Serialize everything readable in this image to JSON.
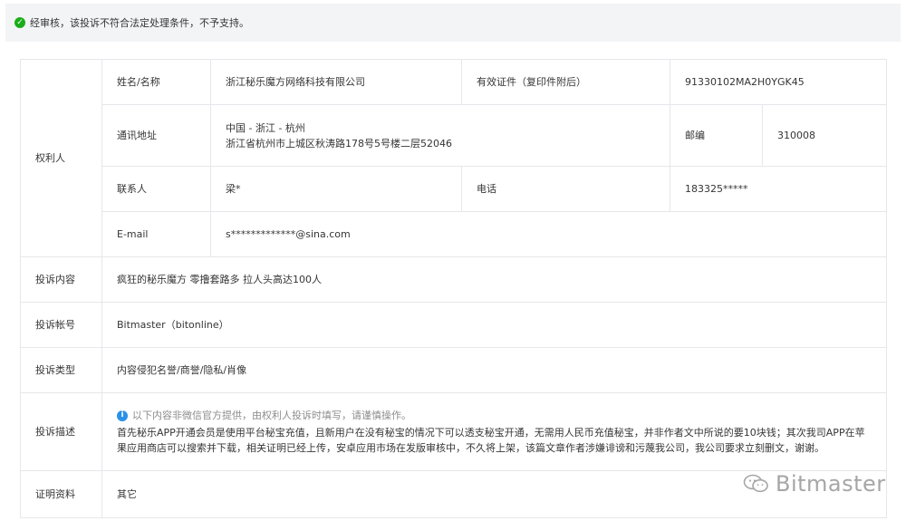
{
  "notice": {
    "text": "经审核，该投诉不符合法定处理条件，不予支持。",
    "icon": "check-circle-icon",
    "color": "#1aad19"
  },
  "rights_holder": {
    "section_label": "权利人",
    "name_label": "姓名/名称",
    "name_value": "浙江秘乐魔方网络科技有限公司",
    "cert_label": "有效证件（复印件附后）",
    "cert_value": "91330102MA2H0YGK45",
    "address_label": "通讯地址",
    "address_line1": "中国 - 浙江 - 杭州",
    "address_line2": "浙江省杭州市上城区秋涛路178号5号楼二层52046",
    "postcode_label": "邮编",
    "postcode_value": "310008",
    "contact_label": "联系人",
    "contact_value": "梁*",
    "phone_label": "电话",
    "phone_value": "183325*****",
    "email_label": "E-mail",
    "email_value": "s*************@sina.com"
  },
  "complaint": {
    "content_label": "投诉内容",
    "content_value": "疯狂的秘乐魔方 零撸套路多 拉人头高达100人",
    "account_label": "投诉帐号",
    "account_value": "Bitmaster（bitonline）",
    "type_label": "投诉类型",
    "type_value": "内容侵犯名誉/商誉/隐私/肖像",
    "desc_label": "投诉描述",
    "desc_tip": "以下内容非微信官方提供，由权利人投诉时填写，请谨慎操作。",
    "desc_text": "首先秘乐APP开通会员是使用平台秘宝充值，且新用户在没有秘宝的情况下可以透支秘宝开通，无需用人民币充值秘宝，并非作者文中所说的要10块钱；其次我司APP在苹果应用商店可以搜索并下载，相关证明已经上传，安卓应用市场在发版审核中，不久将上架，该篇文章作者涉嫌诽谤和污蔑我公司，我公司要求立刻删文，谢谢。",
    "proof_label": "证明资料",
    "proof_value": "其它"
  },
  "watermark": {
    "text": "Bitmaster",
    "icon": "wechat-icon"
  }
}
